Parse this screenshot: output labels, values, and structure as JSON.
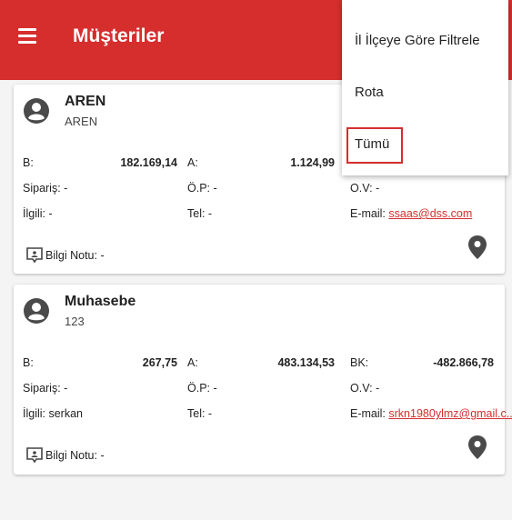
{
  "appbar": {
    "title": "Müşteriler",
    "color": "#d62d2d"
  },
  "customers": [
    {
      "name": "AREN",
      "subtitle": "AREN",
      "b_label": "B:",
      "b_value": "182.169,14",
      "a_label": "A:",
      "a_value": "1.124,99",
      "bk_label": "",
      "bk_value": "",
      "siparis": "Sipariş: -",
      "op": "Ö.P: -",
      "ov": "O.V: -",
      "ilgili": "İlgili: -",
      "tel": "Tel: -",
      "email_label": "E-mail:",
      "email": "ssaas@dss.com",
      "note": "Bilgi Notu: -"
    },
    {
      "name": "Muhasebe",
      "subtitle": "123",
      "b_label": "B:",
      "b_value": "267,75",
      "a_label": "A:",
      "a_value": "483.134,53",
      "bk_label": "BK:",
      "bk_value": "-482.866,78",
      "siparis": "Sipariş: -",
      "op": "Ö.P: -",
      "ov": "O.V: -",
      "ilgili": "İlgili: serkan",
      "tel": "Tel: -",
      "email_label": "E-mail:",
      "email": "srkn1980ylmz@gmail.c...",
      "note": "Bilgi Notu: -"
    }
  ],
  "menu": {
    "items": [
      "İl İlçeye Göre Filtrele",
      "Rota",
      "Tümü"
    ],
    "selected": "Tümü"
  },
  "icons": [
    "menu-icon",
    "person-icon",
    "note-icon",
    "location-pin-icon"
  ]
}
